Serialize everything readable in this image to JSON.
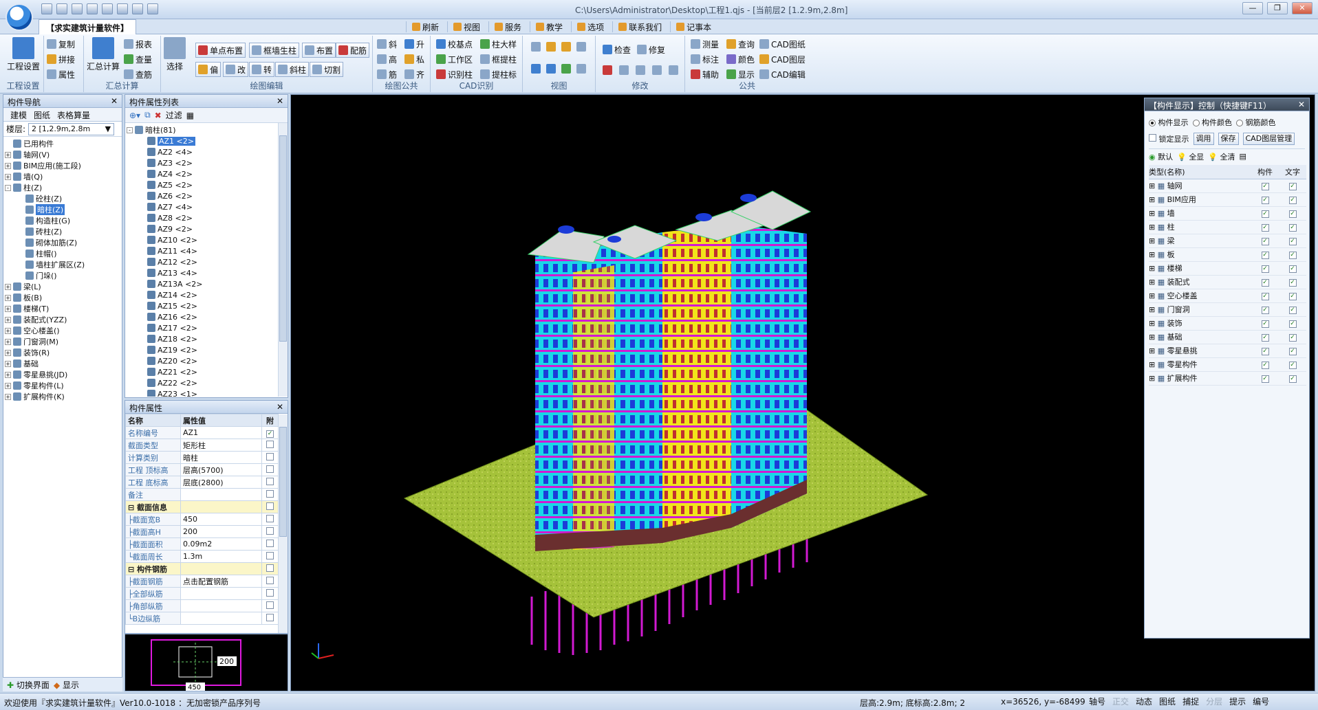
{
  "title": "C:\\Users\\Administrator\\Desktop\\工程1.qjs - [当前层2 [1.2.9m,2.8m]",
  "app_tab": "【求实建筑计量软件】",
  "top_menu": [
    "刷新",
    "视图",
    "服务",
    "教学",
    "选项",
    "联系我们",
    "记事本"
  ],
  "ribbon": {
    "groups": [
      "工程设置",
      "汇总计算",
      "绘图编辑",
      "绘图公共",
      "CAD识别",
      "视图",
      "修改",
      "公共"
    ],
    "project_settings": "工程设置",
    "summary": {
      "big": "汇总计算",
      "items": [
        "报表",
        "查量",
        "查筋"
      ]
    },
    "edit_small": [
      "复制",
      "拼接",
      "属性"
    ],
    "select": "选择",
    "draw": [
      "单点布置",
      "框墙生柱",
      "布置",
      "配筋",
      "偏",
      "改",
      "转",
      "斜柱",
      "切割"
    ],
    "common_draw": [
      "斜",
      "升",
      "高",
      "私",
      "筋",
      "齐"
    ],
    "cad": [
      "校基点",
      "柱大样",
      "工作区",
      "框提柱",
      "识别柱",
      "提柱标"
    ],
    "modify": [
      "检查",
      "修复"
    ],
    "public": [
      "测量",
      "查询",
      "CAD图纸",
      "标注",
      "颜色",
      "CAD图层",
      "辅助",
      "显示",
      "CAD编辑"
    ]
  },
  "nav": {
    "title": "构件导航",
    "tabs": [
      "建模",
      "图纸",
      "表格算量"
    ],
    "floor_label": "楼层:",
    "floor_value": "2 [1,2.9m,2.8m",
    "tree": [
      {
        "label": "已用构件",
        "level": 0
      },
      {
        "label": "轴网(V)",
        "level": 0,
        "pm": "+"
      },
      {
        "label": "BIM应用(施工段)",
        "level": 0,
        "pm": "+"
      },
      {
        "label": "墙(Q)",
        "level": 0,
        "pm": "+"
      },
      {
        "label": "柱(Z)",
        "level": 0,
        "pm": "-"
      },
      {
        "label": "砼柱(Z)",
        "level": 1
      },
      {
        "label": "暗柱(Z)",
        "level": 1,
        "sel": true
      },
      {
        "label": "构造柱(G)",
        "level": 1
      },
      {
        "label": "砖柱(Z)",
        "level": 1
      },
      {
        "label": "砌体加筋(Z)",
        "level": 1
      },
      {
        "label": "柱帽()",
        "level": 1
      },
      {
        "label": "墙柱扩展区(Z)",
        "level": 1
      },
      {
        "label": "门垛()",
        "level": 1
      },
      {
        "label": "梁(L)",
        "level": 0,
        "pm": "+"
      },
      {
        "label": "板(B)",
        "level": 0,
        "pm": "+"
      },
      {
        "label": "楼梯(T)",
        "level": 0,
        "pm": "+"
      },
      {
        "label": "装配式(YZZ)",
        "level": 0,
        "pm": "+"
      },
      {
        "label": "空心楼盖()",
        "level": 0,
        "pm": "+"
      },
      {
        "label": "门窗洞(M)",
        "level": 0,
        "pm": "+"
      },
      {
        "label": "装饰(R)",
        "level": 0,
        "pm": "+"
      },
      {
        "label": "基础",
        "level": 0,
        "pm": "+"
      },
      {
        "label": "零星悬挑(JD)",
        "level": 0,
        "pm": "+"
      },
      {
        "label": "零星构件(L)",
        "level": 0,
        "pm": "+"
      },
      {
        "label": "扩展构件(K)",
        "level": 0,
        "pm": "+"
      }
    ],
    "footer": [
      "切换界面",
      "显示"
    ]
  },
  "clist": {
    "title": "构件属性列表",
    "filter": "过滤",
    "root": "暗柱(81)",
    "items": [
      "AZ1 <2>",
      "AZ2 <4>",
      "AZ3 <2>",
      "AZ4 <2>",
      "AZ5 <2>",
      "AZ6 <2>",
      "AZ7 <4>",
      "AZ8 <2>",
      "AZ9 <2>",
      "AZ10 <2>",
      "AZ11 <4>",
      "AZ12 <2>",
      "AZ13 <4>",
      "AZ13A <2>",
      "AZ14 <2>",
      "AZ15 <2>",
      "AZ16 <2>",
      "AZ17 <2>",
      "AZ18 <2>",
      "AZ19 <2>",
      "AZ20 <2>",
      "AZ21 <2>",
      "AZ22 <2>",
      "AZ23 <1>"
    ]
  },
  "props": {
    "title": "构件属性",
    "headers": [
      "名称",
      "属性值",
      "附"
    ],
    "rows": [
      {
        "n": "名称编号",
        "v": "AZ1",
        "c": true
      },
      {
        "n": "截面类型",
        "v": "矩形柱",
        "c": false
      },
      {
        "n": "计算类别",
        "v": "暗柱",
        "c": false
      },
      {
        "n": "工程 顶标高",
        "v": "层高(5700)",
        "c": false
      },
      {
        "n": "工程 底标高",
        "v": "层底(2800)",
        "c": false
      },
      {
        "n": "备注",
        "v": "",
        "c": false
      },
      {
        "n": "⊟ 截面信息",
        "v": "",
        "c": false,
        "grp": true
      },
      {
        "n": "├截面宽B",
        "v": "450",
        "c": false
      },
      {
        "n": "├截面高H",
        "v": "200",
        "c": false
      },
      {
        "n": "├截面面积",
        "v": "0.09m2",
        "c": false
      },
      {
        "n": "└截面周长",
        "v": "1.3m",
        "c": false
      },
      {
        "n": "⊟ 构件钢筋",
        "v": "",
        "c": false,
        "grp": true
      },
      {
        "n": "├截面钢筋",
        "v": "点击配置钢筋",
        "c": false
      },
      {
        "n": "├全部纵筋",
        "v": "",
        "c": false
      },
      {
        "n": "├角部纵筋",
        "v": "",
        "c": false
      },
      {
        "n": "└B边纵筋",
        "v": "",
        "c": false
      }
    ],
    "preview_dims": [
      "200",
      "450"
    ]
  },
  "disp": {
    "title": "【构件显示】控制（快捷键F11）",
    "radios": [
      "构件显示",
      "构件颜色",
      "钢筋颜色"
    ],
    "lock": "锁定显示",
    "btns": [
      "调用",
      "保存",
      "CAD图层管理"
    ],
    "tools": [
      "默认",
      "全显",
      "全清"
    ],
    "headers": [
      "类型(名称)",
      "构件",
      "文字"
    ],
    "rows": [
      "轴网",
      "BIM应用",
      "墙",
      "柱",
      "梁",
      "板",
      "楼梯",
      "装配式",
      "空心楼盖",
      "门窗洞",
      "装饰",
      "基础",
      "零星悬挑",
      "零星构件",
      "扩展构件"
    ]
  },
  "status": {
    "welcome": "欢迎使用『求实建筑计量软件』Ver10.0-1018 ：无加密锁产品序列号",
    "floor": "层高:2.9m; 底标高:2.8m; 2",
    "coords": "x=36526, y=-68499",
    "buttons": [
      "轴号",
      "正交",
      "动态",
      "图纸",
      "捕捉",
      "分层",
      "提示",
      "编号"
    ]
  },
  "colors": {
    "cyan": "#19d7e8",
    "yellow": "#f2e41a",
    "magenta": "#d21ad2",
    "grass": "#a5c23a",
    "roof": "#d8d8d8",
    "blue": "#1c3cd8"
  }
}
